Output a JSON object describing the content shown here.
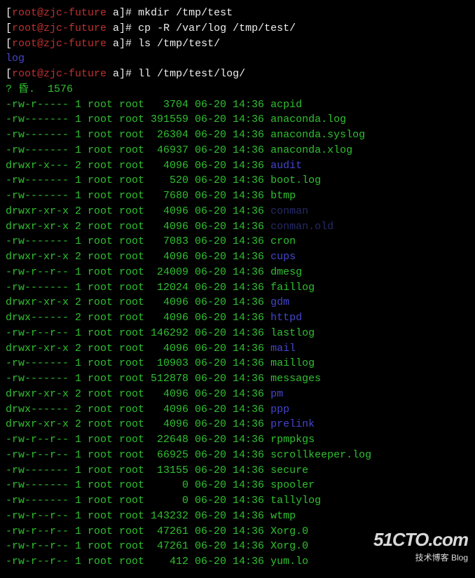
{
  "prompt": {
    "open": "[",
    "userhost": "root@zjc-future",
    "space": " ",
    "cwd": "a",
    "close": "]# "
  },
  "commands": [
    {
      "text": "mkdir /tmp/test"
    },
    {
      "text": "cp -R /var/log /tmp/test/"
    },
    {
      "text": "ls /tmp/test/"
    }
  ],
  "ls_output": "log",
  "commands2": [
    {
      "text": "ll /tmp/test/log/"
    }
  ],
  "total_line": "? 昏.  1576",
  "files": [
    {
      "perms": "-rw-r-----",
      "links": "1",
      "owner": "root",
      "group": "root",
      "size": "3704",
      "date": "06-20 14:36",
      "name": "acpid",
      "cls": "green"
    },
    {
      "perms": "-rw-------",
      "links": "1",
      "owner": "root",
      "group": "root",
      "size": "391559",
      "date": "06-20 14:36",
      "name": "anaconda.log",
      "cls": "green"
    },
    {
      "perms": "-rw-------",
      "links": "1",
      "owner": "root",
      "group": "root",
      "size": "26304",
      "date": "06-20 14:36",
      "name": "anaconda.syslog",
      "cls": "green"
    },
    {
      "perms": "-rw-------",
      "links": "1",
      "owner": "root",
      "group": "root",
      "size": "46937",
      "date": "06-20 14:36",
      "name": "anaconda.xlog",
      "cls": "green"
    },
    {
      "perms": "drwxr-x---",
      "links": "2",
      "owner": "root",
      "group": "root",
      "size": "4096",
      "date": "06-20 14:36",
      "name": "audit",
      "cls": "blue"
    },
    {
      "perms": "-rw-------",
      "links": "1",
      "owner": "root",
      "group": "root",
      "size": "520",
      "date": "06-20 14:36",
      "name": "boot.log",
      "cls": "green"
    },
    {
      "perms": "-rw-------",
      "links": "1",
      "owner": "root",
      "group": "root",
      "size": "7680",
      "date": "06-20 14:36",
      "name": "btmp",
      "cls": "green"
    },
    {
      "perms": "drwxr-xr-x",
      "links": "2",
      "owner": "root",
      "group": "root",
      "size": "4096",
      "date": "06-20 14:36",
      "name": "conman",
      "cls": "faded"
    },
    {
      "perms": "drwxr-xr-x",
      "links": "2",
      "owner": "root",
      "group": "root",
      "size": "4096",
      "date": "06-20 14:36",
      "name": "conman.old",
      "cls": "faded"
    },
    {
      "perms": "-rw-------",
      "links": "1",
      "owner": "root",
      "group": "root",
      "size": "7083",
      "date": "06-20 14:36",
      "name": "cron",
      "cls": "green"
    },
    {
      "perms": "drwxr-xr-x",
      "links": "2",
      "owner": "root",
      "group": "root",
      "size": "4096",
      "date": "06-20 14:36",
      "name": "cups",
      "cls": "blue"
    },
    {
      "perms": "-rw-r--r--",
      "links": "1",
      "owner": "root",
      "group": "root",
      "size": "24009",
      "date": "06-20 14:36",
      "name": "dmesg",
      "cls": "green"
    },
    {
      "perms": "-rw-------",
      "links": "1",
      "owner": "root",
      "group": "root",
      "size": "12024",
      "date": "06-20 14:36",
      "name": "faillog",
      "cls": "green"
    },
    {
      "perms": "drwxr-xr-x",
      "links": "2",
      "owner": "root",
      "group": "root",
      "size": "4096",
      "date": "06-20 14:36",
      "name": "gdm",
      "cls": "blue"
    },
    {
      "perms": "drwx------",
      "links": "2",
      "owner": "root",
      "group": "root",
      "size": "4096",
      "date": "06-20 14:36",
      "name": "httpd",
      "cls": "blue"
    },
    {
      "perms": "-rw-r--r--",
      "links": "1",
      "owner": "root",
      "group": "root",
      "size": "146292",
      "date": "06-20 14:36",
      "name": "lastlog",
      "cls": "green"
    },
    {
      "perms": "drwxr-xr-x",
      "links": "2",
      "owner": "root",
      "group": "root",
      "size": "4096",
      "date": "06-20 14:36",
      "name": "mail",
      "cls": "blue"
    },
    {
      "perms": "-rw-------",
      "links": "1",
      "owner": "root",
      "group": "root",
      "size": "10903",
      "date": "06-20 14:36",
      "name": "maillog",
      "cls": "green"
    },
    {
      "perms": "-rw-------",
      "links": "1",
      "owner": "root",
      "group": "root",
      "size": "512878",
      "date": "06-20 14:36",
      "name": "messages",
      "cls": "green"
    },
    {
      "perms": "drwxr-xr-x",
      "links": "2",
      "owner": "root",
      "group": "root",
      "size": "4096",
      "date": "06-20 14:36",
      "name": "pm",
      "cls": "blue"
    },
    {
      "perms": "drwx------",
      "links": "2",
      "owner": "root",
      "group": "root",
      "size": "4096",
      "date": "06-20 14:36",
      "name": "ppp",
      "cls": "blue"
    },
    {
      "perms": "drwxr-xr-x",
      "links": "2",
      "owner": "root",
      "group": "root",
      "size": "4096",
      "date": "06-20 14:36",
      "name": "prelink",
      "cls": "blue"
    },
    {
      "perms": "-rw-r--r--",
      "links": "1",
      "owner": "root",
      "group": "root",
      "size": "22648",
      "date": "06-20 14:36",
      "name": "rpmpkgs",
      "cls": "green"
    },
    {
      "perms": "-rw-r--r--",
      "links": "1",
      "owner": "root",
      "group": "root",
      "size": "66925",
      "date": "06-20 14:36",
      "name": "scrollkeeper.log",
      "cls": "green"
    },
    {
      "perms": "-rw-------",
      "links": "1",
      "owner": "root",
      "group": "root",
      "size": "13155",
      "date": "06-20 14:36",
      "name": "secure",
      "cls": "green"
    },
    {
      "perms": "-rw-------",
      "links": "1",
      "owner": "root",
      "group": "root",
      "size": "0",
      "date": "06-20 14:36",
      "name": "spooler",
      "cls": "green"
    },
    {
      "perms": "-rw-------",
      "links": "1",
      "owner": "root",
      "group": "root",
      "size": "0",
      "date": "06-20 14:36",
      "name": "tallylog",
      "cls": "green"
    },
    {
      "perms": "-rw-r--r--",
      "links": "1",
      "owner": "root",
      "group": "root",
      "size": "143232",
      "date": "06-20 14:36",
      "name": "wtmp",
      "cls": "green"
    },
    {
      "perms": "-rw-r--r--",
      "links": "1",
      "owner": "root",
      "group": "root",
      "size": "47261",
      "date": "06-20 14:36",
      "name": "Xorg.0",
      "cls": "green"
    },
    {
      "perms": "-rw-r--r--",
      "links": "1",
      "owner": "root",
      "group": "root",
      "size": "47261",
      "date": "06-20 14:36",
      "name": "Xorg.0",
      "cls": "green"
    },
    {
      "perms": "-rw-r--r--",
      "links": "1",
      "owner": "root",
      "group": "root",
      "size": "412",
      "date": "06-20 14:36",
      "name": "yum.lo",
      "cls": "green"
    }
  ],
  "watermark": {
    "big": "51CTO.com",
    "small": "技术博客   Blog"
  }
}
